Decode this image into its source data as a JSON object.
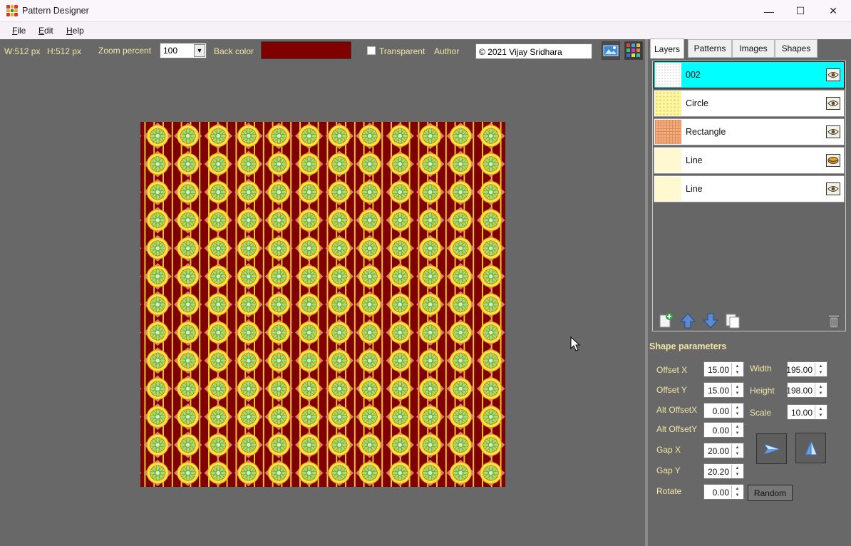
{
  "window": {
    "title": "Pattern Designer",
    "minimize": "—",
    "maximize": "☐",
    "close": "✕"
  },
  "menu": [
    {
      "key": "F",
      "rest": "ile"
    },
    {
      "key": "E",
      "rest": "dit"
    },
    {
      "key": "H",
      "rest": "elp"
    }
  ],
  "toolbar": {
    "width": "W:512 px",
    "height": "H:512 px",
    "zoom_label": "Zoom percent",
    "zoom_value": "100",
    "back_color_label": "Back color",
    "back_color": "#800000",
    "transparent_label": "Transparent",
    "transparent_checked": false,
    "author_label": "Author",
    "author_value": "© 2021 Vijay Sridhara"
  },
  "tabs": [
    "Layers",
    "Patterns",
    "Images",
    "Shapes"
  ],
  "active_tab": "Layers",
  "layers": [
    {
      "name": "002",
      "selected": true,
      "visible": true
    },
    {
      "name": "Circle",
      "selected": false,
      "visible": true
    },
    {
      "name": "Rectangle",
      "selected": false,
      "visible": true
    },
    {
      "name": "Line",
      "selected": false,
      "visible": false
    },
    {
      "name": "Line",
      "selected": false,
      "visible": true
    }
  ],
  "shape_params": {
    "title": "Shape parameters",
    "offset_x_label": "Offset X",
    "offset_x": "15.00",
    "offset_y_label": "Offset Y",
    "offset_y": "15.00",
    "alt_offset_x_label": "Alt OffsetX",
    "alt_offset_x": "0.00",
    "alt_offset_y_label": "Alt OffsetY",
    "alt_offset_y": "0.00",
    "gap_x_label": "Gap X",
    "gap_x": "20.00",
    "gap_y_label": "Gap Y",
    "gap_y": "20.20",
    "rotate_label": "Rotate",
    "rotate": "0.00",
    "width_label": "Width",
    "width": "195.00",
    "height_label": "Height",
    "height": "198.00",
    "scale_label": "Scale",
    "scale": "10.00",
    "random_label": "Random"
  },
  "colors": {
    "label": "#f2e6a6",
    "selected_layer": "#00ffff",
    "pattern_background": "#800000",
    "pattern_stripe": "#e8c040",
    "flower_disc": "#ffe24a",
    "flower_center": "#8fd06a"
  },
  "icons": [
    "app-icon",
    "eye-icon",
    "add-layer-icon",
    "move-up-icon",
    "move-down-icon",
    "duplicate-icon",
    "trash-icon",
    "flip-horizontal-icon",
    "flip-vertical-icon",
    "image-icon",
    "palette-grid-icon"
  ]
}
